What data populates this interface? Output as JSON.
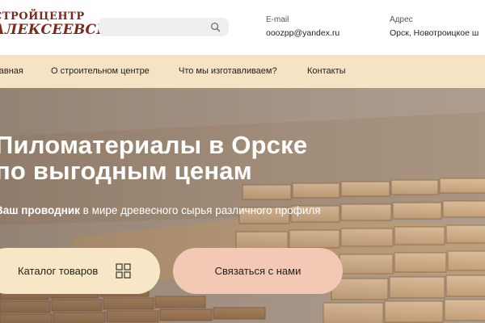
{
  "logo": {
    "line1": "СТРОЙЦЕНТР",
    "line2": "АЛЕКСЕЕВСКИЙ"
  },
  "search": {
    "value": "",
    "placeholder": "",
    "icon": "search-icon"
  },
  "contacts": {
    "email_label": "E-mail",
    "email_value": "ooozpp@yandex.ru",
    "address_label": "Адрес",
    "address_value": "Орск, Новотроицкое ш"
  },
  "nav": {
    "items": [
      {
        "label": "Главная"
      },
      {
        "label": "О строительном центре"
      },
      {
        "label": "Что мы изготавливаем?"
      },
      {
        "label": "Контакты"
      }
    ]
  },
  "hero": {
    "title_line1": "Пиломатериалы в Орске",
    "title_line2": "по выгодным ценам",
    "subtitle_bold": "Ваш проводник",
    "subtitle_rest": " в мире древесного сырья различного профиля",
    "catalog_button": "Каталог товаров",
    "catalog_icon": "grid-icon",
    "contact_button": "Связаться с нами"
  },
  "colors": {
    "nav_bg": "#f6e2c4",
    "logo": "#7a2a1d",
    "catalog_button_bg": "#f7e7c6",
    "contact_button_bg": "#f3c8b4"
  }
}
